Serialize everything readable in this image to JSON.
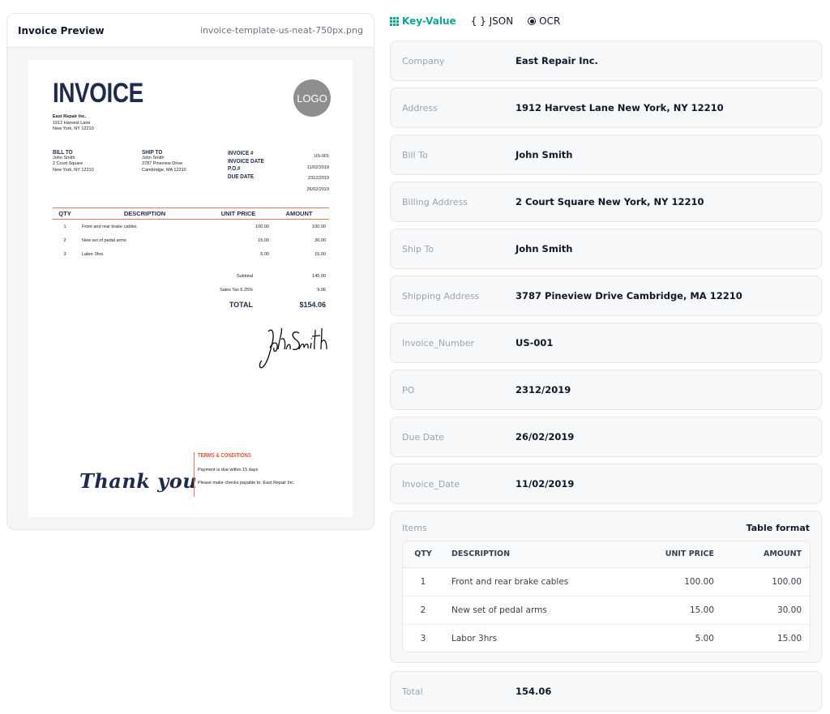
{
  "preview": {
    "title": "Invoice Preview",
    "filename": "invoice-template-us-neat-750px.png"
  },
  "invoice_doc": {
    "heading": "INVOICE",
    "logo_text": "LOGO",
    "from": {
      "name": "East Repair Inc.",
      "line1": "1912 Harvest Lane",
      "line2": "New York, NY 12210"
    },
    "bill_to": {
      "label": "BILL TO",
      "name": "John Smith",
      "line1": "2 Court Square",
      "line2": "New York, NY 12210"
    },
    "ship_to": {
      "label": "SHIP TO",
      "name": "John Smith",
      "line1": "3787 Pineview Drive",
      "line2": "Cambridge, MA 12210"
    },
    "meta": {
      "invoice_no_label": "INVOICE #",
      "invoice_date_label": "INVOICE DATE",
      "po_label": "P.O.#",
      "due_date_label": "DUE DATE",
      "invoice_no": "US-001",
      "invoice_date": "11/02/2019",
      "po": "2312/2019",
      "due_date": "26/02/2019"
    },
    "columns": {
      "qty": "QTY",
      "description": "DESCRIPTION",
      "unit_price": "UNIT PRICE",
      "amount": "AMOUNT"
    },
    "rows": [
      {
        "qty": "1",
        "description": "Front and rear brake cables",
        "unit_price": "100.00",
        "amount": "100.00"
      },
      {
        "qty": "2",
        "description": "New set of pedal arms",
        "unit_price": "15.00",
        "amount": "30.00"
      },
      {
        "qty": "3",
        "description": "Labor 3hrs",
        "unit_price": "5.00",
        "amount": "15.00"
      }
    ],
    "subtotal_label": "Subtotal",
    "subtotal": "145.00",
    "tax_label": "Sales Tax 6.25%",
    "tax": "9.06",
    "total_label": "TOTAL",
    "total": "$154.06",
    "signature": "John Smith",
    "thank_you": "Thank you",
    "terms_heading": "TERMS & CONDITIONS",
    "terms_line1": "Payment is due within 15 days",
    "terms_line2": "Please make checks payable to: East Repair Inc."
  },
  "tabs": [
    {
      "label": "Key-Value",
      "icon": "grid-icon",
      "active": true
    },
    {
      "label": "{ } JSON",
      "active": false
    },
    {
      "label": "OCR",
      "icon": "radio-icon",
      "active": false
    }
  ],
  "fields": [
    {
      "key": "Company",
      "value": "East Repair Inc."
    },
    {
      "key": "Address",
      "value": "1912 Harvest Lane New York, NY 12210"
    },
    {
      "key": "Bill To",
      "value": "John Smith"
    },
    {
      "key": "Billing Address",
      "value": "2 Court Square New York, NY 12210"
    },
    {
      "key": "Ship To",
      "value": "John Smith"
    },
    {
      "key": "Shipping Address",
      "value": "3787 Pineview Drive Cambridge, MA 12210"
    },
    {
      "key": "Invoice_Number",
      "value": "US-001"
    },
    {
      "key": "PO",
      "value": "2312/2019"
    },
    {
      "key": "Due Date",
      "value": "26/02/2019"
    },
    {
      "key": "Invoice_Date",
      "value": "11/02/2019"
    }
  ],
  "items": {
    "label": "Items",
    "format_label": "Table format",
    "columns": [
      "QTY",
      "DESCRIPTION",
      "UNIT PRICE",
      "AMOUNT"
    ],
    "rows": [
      {
        "qty": "1",
        "description": "Front and rear brake cables",
        "unit_price": "100.00",
        "amount": "100.00"
      },
      {
        "qty": "2",
        "description": "New set of pedal arms",
        "unit_price": "15.00",
        "amount": "30.00"
      },
      {
        "qty": "3",
        "description": "Labor 3hrs",
        "unit_price": "5.00",
        "amount": "15.00"
      }
    ]
  },
  "total_field": {
    "key": "Total",
    "value": "154.06"
  },
  "colors": {
    "accent": "#0fa88c",
    "invoice_navy": "#1f2a4d",
    "invoice_coral": "#e07a60"
  }
}
